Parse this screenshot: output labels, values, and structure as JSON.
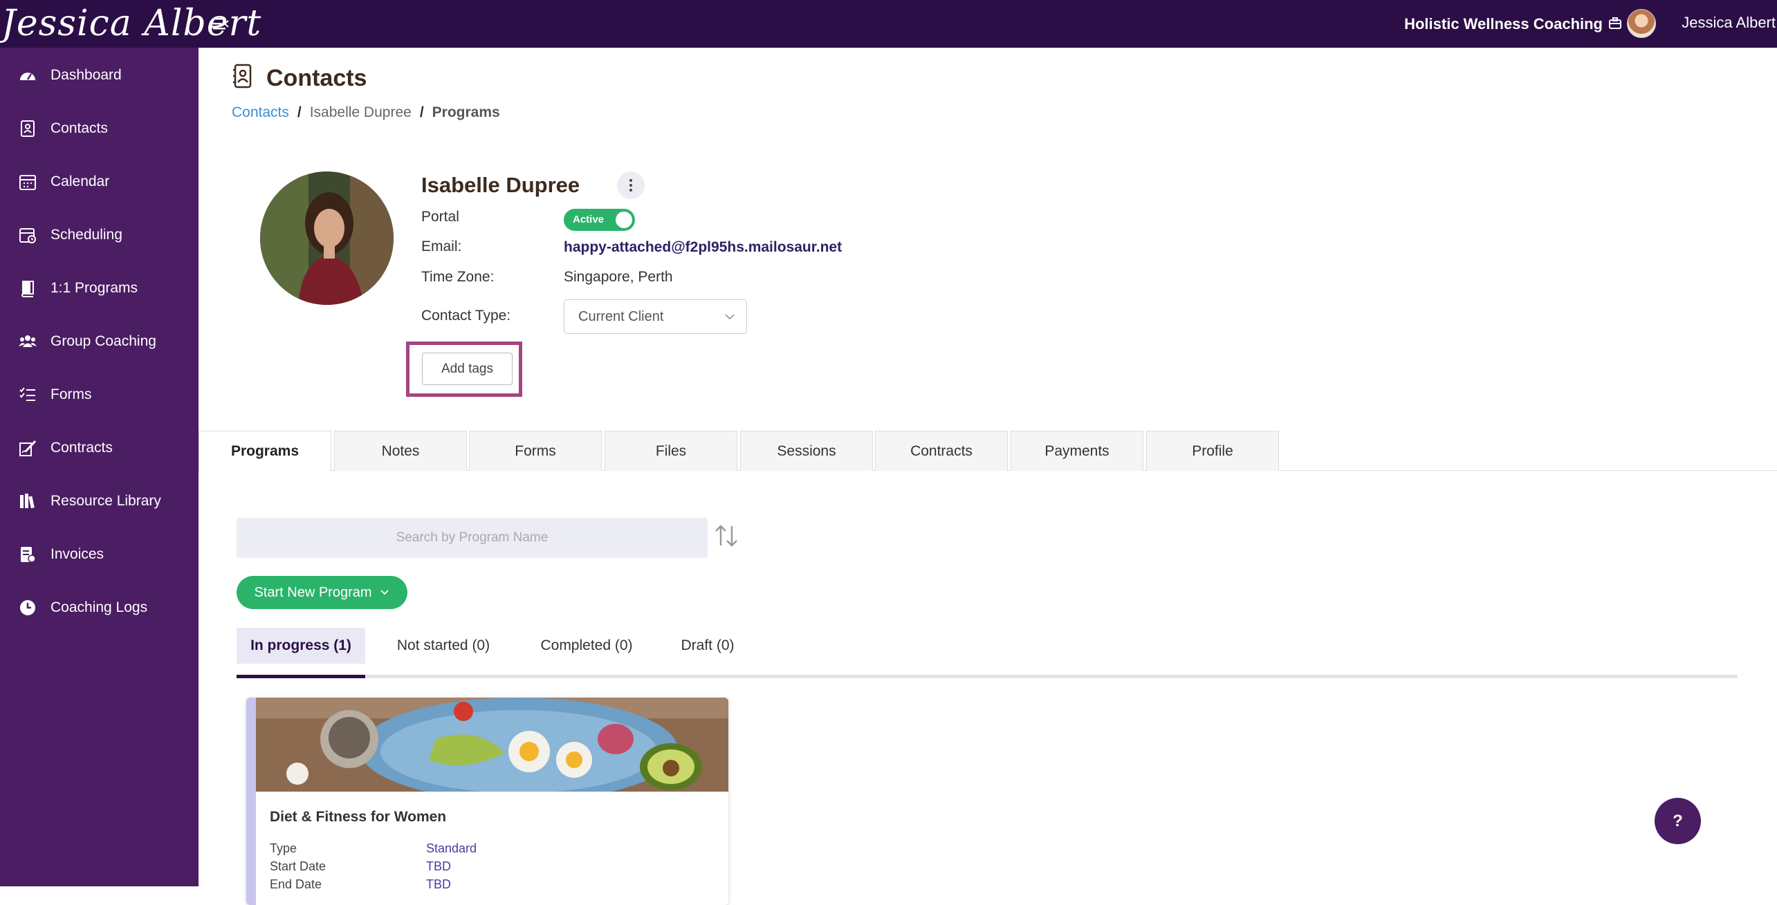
{
  "topbar": {
    "brand": "Jessica Albert",
    "org_name": "Holistic Wellness Coaching",
    "user_name": "Jessica Albert"
  },
  "sidebar": {
    "items": [
      {
        "label": "Dashboard",
        "icon": "dashboard-icon"
      },
      {
        "label": "Contacts",
        "icon": "contacts-icon"
      },
      {
        "label": "Calendar",
        "icon": "calendar-icon"
      },
      {
        "label": "Scheduling",
        "icon": "scheduling-icon"
      },
      {
        "label": "1:1 Programs",
        "icon": "book-icon"
      },
      {
        "label": "Group Coaching",
        "icon": "group-icon"
      },
      {
        "label": "Forms",
        "icon": "checklist-icon"
      },
      {
        "label": "Contracts",
        "icon": "signature-icon"
      },
      {
        "label": "Resource Library",
        "icon": "library-icon"
      },
      {
        "label": "Invoices",
        "icon": "invoice-icon"
      },
      {
        "label": "Coaching Logs",
        "icon": "clock-icon"
      }
    ]
  },
  "page": {
    "title": "Contacts",
    "breadcrumb": [
      "Contacts",
      "Isabelle Dupree",
      "Programs"
    ]
  },
  "contact": {
    "name": "Isabelle Dupree",
    "portal_label": "Portal",
    "portal_status": "Active",
    "email_label": "Email:",
    "email": "happy-attached@f2pl95hs.mailosaur.net",
    "timezone_label": "Time Zone:",
    "timezone": "Singapore, Perth",
    "contact_type_label": "Contact Type:",
    "contact_type": "Current Client",
    "add_tags": "Add tags"
  },
  "tabs": [
    "Programs",
    "Notes",
    "Forms",
    "Files",
    "Sessions",
    "Contracts",
    "Payments",
    "Profile"
  ],
  "programs": {
    "search_placeholder": "Search by Program Name",
    "start_button": "Start New Program",
    "subtabs": [
      "In progress (1)",
      "Not started (0)",
      "Completed (0)",
      "Draft (0)"
    ],
    "card": {
      "title": "Diet & Fitness for Women",
      "rows": [
        {
          "label": "Type",
          "value": "Standard"
        },
        {
          "label": "Start Date",
          "value": "TBD"
        },
        {
          "label": "End Date",
          "value": "TBD"
        }
      ]
    }
  },
  "help_label": "?",
  "colors": {
    "topbar": "#2a0e45",
    "sidebar": "#4b1d63",
    "accent_green": "#2bb36a",
    "highlight": "#a5467f",
    "link_blue": "#3a8fd6"
  }
}
